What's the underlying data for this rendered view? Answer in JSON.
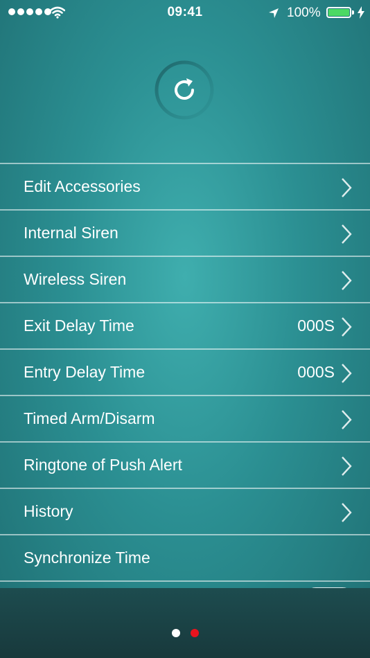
{
  "status_bar": {
    "time": "09:41",
    "battery_percent": "100%",
    "signal_bars": 5,
    "battery_color": "#4cd964"
  },
  "refresh": {
    "icon": "refresh-icon"
  },
  "settings": {
    "items": [
      {
        "label": "Edit Accessories",
        "value": "",
        "has_chevron": true
      },
      {
        "label": "Internal Siren",
        "value": "",
        "has_chevron": true
      },
      {
        "label": "Wireless Siren",
        "value": "",
        "has_chevron": true
      },
      {
        "label": "Exit Delay Time",
        "value": "000S",
        "has_chevron": true
      },
      {
        "label": "Entry Delay Time",
        "value": "000S",
        "has_chevron": true
      },
      {
        "label": "Timed Arm/Disarm",
        "value": "",
        "has_chevron": true
      },
      {
        "label": "Ringtone of Push Alert",
        "value": "",
        "has_chevron": true
      },
      {
        "label": "History",
        "value": "",
        "has_chevron": true
      },
      {
        "label": "Synchronize Time",
        "value": "",
        "has_chevron": false
      }
    ]
  },
  "pager": {
    "pages": 2,
    "current_index": 1,
    "inactive_color": "#ffffff",
    "active_color": "#e8141e"
  }
}
